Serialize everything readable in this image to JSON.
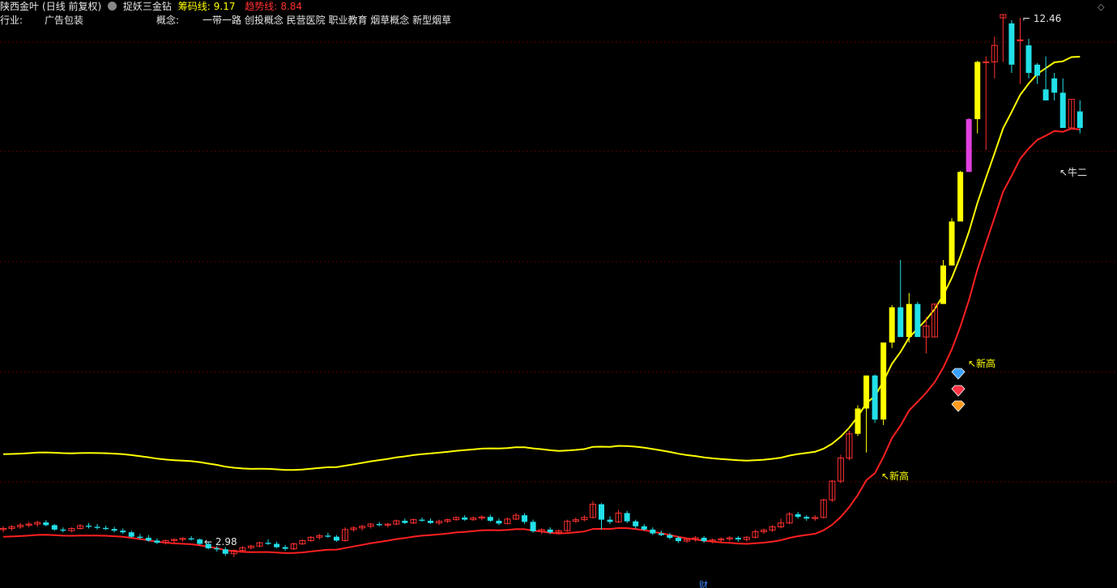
{
  "header": {
    "stock_name": "陕西金叶",
    "period_label": "(日线 前复权)",
    "indicator_name": "捉妖三金钻",
    "chip_line_label": "筹码线:",
    "chip_line_value": "9.17",
    "trend_line_label": "趋势线:",
    "trend_line_value": "8.84",
    "industry_label": "行业:",
    "industry_value": "广告包装",
    "concept_label": "概念:",
    "concept_value": "一带一路 创投概念 民营医院 职业教育 烟草概念 新型烟草"
  },
  "colors": {
    "background": "#000000",
    "up_candle": "#ff3030",
    "down_candle": "#22e0e8",
    "signal_candle": "#ffff00",
    "special_candle": "#e040e0",
    "chip_line": "#ffff00",
    "trend_line": "#ff2020",
    "grid": "#5a0000"
  },
  "chart_data": {
    "type": "candlestick",
    "max_price_label": "12.46",
    "min_price_label": "2.98",
    "annotations": [
      "新高",
      "新高",
      "牛二"
    ],
    "bottom_marker": "财",
    "diamond_icons": [
      "blue-diamond",
      "red-diamond",
      "orange-diamond"
    ],
    "candles": [
      {
        "o": 3.1,
        "h": 3.16,
        "l": 3.05,
        "c": 3.12
      },
      {
        "o": 3.12,
        "h": 3.18,
        "l": 3.08,
        "c": 3.15
      },
      {
        "o": 3.15,
        "h": 3.22,
        "l": 3.11,
        "c": 3.18
      },
      {
        "o": 3.18,
        "h": 3.24,
        "l": 3.14,
        "c": 3.2
      },
      {
        "o": 3.2,
        "h": 3.26,
        "l": 3.15,
        "c": 3.23
      },
      {
        "o": 3.23,
        "h": 3.27,
        "l": 3.16,
        "c": 3.18
      },
      {
        "o": 3.18,
        "h": 3.2,
        "l": 3.08,
        "c": 3.1
      },
      {
        "o": 3.1,
        "h": 3.14,
        "l": 3.05,
        "c": 3.08
      },
      {
        "o": 3.08,
        "h": 3.14,
        "l": 3.05,
        "c": 3.12
      },
      {
        "o": 3.12,
        "h": 3.2,
        "l": 3.1,
        "c": 3.17
      },
      {
        "o": 3.17,
        "h": 3.22,
        "l": 3.12,
        "c": 3.15
      },
      {
        "o": 3.15,
        "h": 3.2,
        "l": 3.1,
        "c": 3.13
      },
      {
        "o": 3.13,
        "h": 3.17,
        "l": 3.09,
        "c": 3.11
      },
      {
        "o": 3.11,
        "h": 3.15,
        "l": 3.05,
        "c": 3.08
      },
      {
        "o": 3.08,
        "h": 3.12,
        "l": 3.02,
        "c": 3.05
      },
      {
        "o": 3.05,
        "h": 3.08,
        "l": 2.95,
        "c": 2.97
      },
      {
        "o": 2.97,
        "h": 3.02,
        "l": 2.92,
        "c": 2.95
      },
      {
        "o": 2.95,
        "h": 3.0,
        "l": 2.88,
        "c": 2.9
      },
      {
        "o": 2.9,
        "h": 2.94,
        "l": 2.84,
        "c": 2.86
      },
      {
        "o": 2.86,
        "h": 2.92,
        "l": 2.83,
        "c": 2.9
      },
      {
        "o": 2.9,
        "h": 2.94,
        "l": 2.85,
        "c": 2.92
      },
      {
        "o": 2.92,
        "h": 2.96,
        "l": 2.88,
        "c": 2.94
      },
      {
        "o": 2.94,
        "h": 2.98,
        "l": 2.9,
        "c": 2.92
      },
      {
        "o": 2.92,
        "h": 2.94,
        "l": 2.82,
        "c": 2.84
      },
      {
        "o": 2.84,
        "h": 2.88,
        "l": 2.74,
        "c": 2.76
      },
      {
        "o": 2.76,
        "h": 2.8,
        "l": 2.7,
        "c": 2.74
      },
      {
        "o": 2.74,
        "h": 2.78,
        "l": 2.62,
        "c": 2.66
      },
      {
        "o": 2.66,
        "h": 2.74,
        "l": 2.6,
        "c": 2.72
      },
      {
        "o": 2.72,
        "h": 2.8,
        "l": 2.7,
        "c": 2.77
      },
      {
        "o": 2.77,
        "h": 2.82,
        "l": 2.74,
        "c": 2.8
      },
      {
        "o": 2.8,
        "h": 2.88,
        "l": 2.78,
        "c": 2.86
      },
      {
        "o": 2.86,
        "h": 2.92,
        "l": 2.82,
        "c": 2.84
      },
      {
        "o": 2.84,
        "h": 2.88,
        "l": 2.76,
        "c": 2.78
      },
      {
        "o": 2.78,
        "h": 2.82,
        "l": 2.72,
        "c": 2.75
      },
      {
        "o": 2.75,
        "h": 2.86,
        "l": 2.73,
        "c": 2.84
      },
      {
        "o": 2.84,
        "h": 2.92,
        "l": 2.82,
        "c": 2.9
      },
      {
        "o": 2.9,
        "h": 2.98,
        "l": 2.88,
        "c": 2.96
      },
      {
        "o": 2.96,
        "h": 3.02,
        "l": 2.92,
        "c": 2.99
      },
      {
        "o": 2.99,
        "h": 3.04,
        "l": 2.95,
        "c": 2.97
      },
      {
        "o": 2.97,
        "h": 3.0,
        "l": 2.88,
        "c": 2.9
      },
      {
        "o": 2.9,
        "h": 3.14,
        "l": 2.88,
        "c": 3.1
      },
      {
        "o": 3.1,
        "h": 3.16,
        "l": 3.06,
        "c": 3.13
      },
      {
        "o": 3.13,
        "h": 3.18,
        "l": 3.08,
        "c": 3.16
      },
      {
        "o": 3.16,
        "h": 3.22,
        "l": 3.12,
        "c": 3.2
      },
      {
        "o": 3.2,
        "h": 3.24,
        "l": 3.16,
        "c": 3.18
      },
      {
        "o": 3.18,
        "h": 3.22,
        "l": 3.14,
        "c": 3.2
      },
      {
        "o": 3.2,
        "h": 3.28,
        "l": 3.18,
        "c": 3.26
      },
      {
        "o": 3.26,
        "h": 3.3,
        "l": 3.2,
        "c": 3.22
      },
      {
        "o": 3.22,
        "h": 3.3,
        "l": 3.2,
        "c": 3.28
      },
      {
        "o": 3.28,
        "h": 3.32,
        "l": 3.24,
        "c": 3.26
      },
      {
        "o": 3.26,
        "h": 3.3,
        "l": 3.2,
        "c": 3.22
      },
      {
        "o": 3.22,
        "h": 3.28,
        "l": 3.18,
        "c": 3.25
      },
      {
        "o": 3.25,
        "h": 3.3,
        "l": 3.22,
        "c": 3.28
      },
      {
        "o": 3.28,
        "h": 3.34,
        "l": 3.26,
        "c": 3.32
      },
      {
        "o": 3.32,
        "h": 3.36,
        "l": 3.26,
        "c": 3.28
      },
      {
        "o": 3.28,
        "h": 3.34,
        "l": 3.26,
        "c": 3.31
      },
      {
        "o": 3.31,
        "h": 3.36,
        "l": 3.27,
        "c": 3.33
      },
      {
        "o": 3.33,
        "h": 3.37,
        "l": 3.24,
        "c": 3.26
      },
      {
        "o": 3.26,
        "h": 3.3,
        "l": 3.18,
        "c": 3.21
      },
      {
        "o": 3.21,
        "h": 3.32,
        "l": 3.19,
        "c": 3.29
      },
      {
        "o": 3.29,
        "h": 3.4,
        "l": 3.27,
        "c": 3.36
      },
      {
        "o": 3.36,
        "h": 3.4,
        "l": 3.2,
        "c": 3.24
      },
      {
        "o": 3.24,
        "h": 3.28,
        "l": 3.04,
        "c": 3.07
      },
      {
        "o": 3.07,
        "h": 3.12,
        "l": 3.02,
        "c": 3.1
      },
      {
        "o": 3.1,
        "h": 3.14,
        "l": 3.02,
        "c": 3.05
      },
      {
        "o": 3.05,
        "h": 3.1,
        "l": 3.02,
        "c": 3.08
      },
      {
        "o": 3.08,
        "h": 3.28,
        "l": 3.06,
        "c": 3.25
      },
      {
        "o": 3.25,
        "h": 3.32,
        "l": 3.22,
        "c": 3.28
      },
      {
        "o": 3.28,
        "h": 3.36,
        "l": 3.25,
        "c": 3.32
      },
      {
        "o": 3.32,
        "h": 3.62,
        "l": 3.3,
        "c": 3.56
      },
      {
        "o": 3.56,
        "h": 3.58,
        "l": 3.1,
        "c": 3.28
      },
      {
        "o": 3.28,
        "h": 3.34,
        "l": 3.2,
        "c": 3.24
      },
      {
        "o": 3.24,
        "h": 3.46,
        "l": 3.22,
        "c": 3.4
      },
      {
        "o": 3.4,
        "h": 3.44,
        "l": 3.22,
        "c": 3.25
      },
      {
        "o": 3.25,
        "h": 3.28,
        "l": 3.12,
        "c": 3.16
      },
      {
        "o": 3.16,
        "h": 3.2,
        "l": 3.08,
        "c": 3.1
      },
      {
        "o": 3.1,
        "h": 3.14,
        "l": 3.0,
        "c": 3.03
      },
      {
        "o": 3.03,
        "h": 3.08,
        "l": 2.98,
        "c": 3.0
      },
      {
        "o": 3.0,
        "h": 3.04,
        "l": 2.92,
        "c": 2.95
      },
      {
        "o": 2.95,
        "h": 2.98,
        "l": 2.86,
        "c": 2.89
      },
      {
        "o": 2.89,
        "h": 2.94,
        "l": 2.86,
        "c": 2.92
      },
      {
        "o": 2.92,
        "h": 2.98,
        "l": 2.88,
        "c": 2.95
      },
      {
        "o": 2.95,
        "h": 2.98,
        "l": 2.86,
        "c": 2.89
      },
      {
        "o": 2.89,
        "h": 2.94,
        "l": 2.85,
        "c": 2.91
      },
      {
        "o": 2.91,
        "h": 2.96,
        "l": 2.87,
        "c": 2.93
      },
      {
        "o": 2.93,
        "h": 2.98,
        "l": 2.89,
        "c": 2.95
      },
      {
        "o": 2.95,
        "h": 2.98,
        "l": 2.88,
        "c": 2.92
      },
      {
        "o": 2.92,
        "h": 2.98,
        "l": 2.88,
        "c": 2.96
      },
      {
        "o": 2.96,
        "h": 3.1,
        "l": 2.94,
        "c": 3.06
      },
      {
        "o": 3.06,
        "h": 3.12,
        "l": 3.02,
        "c": 3.09
      },
      {
        "o": 3.09,
        "h": 3.18,
        "l": 3.06,
        "c": 3.15
      },
      {
        "o": 3.15,
        "h": 3.3,
        "l": 3.12,
        "c": 3.22
      },
      {
        "o": 3.22,
        "h": 3.42,
        "l": 3.2,
        "c": 3.38
      },
      {
        "o": 3.38,
        "h": 3.42,
        "l": 3.3,
        "c": 3.33
      },
      {
        "o": 3.33,
        "h": 3.36,
        "l": 3.26,
        "c": 3.3
      },
      {
        "o": 3.3,
        "h": 3.36,
        "l": 3.26,
        "c": 3.32
      },
      {
        "o": 3.32,
        "h": 3.66,
        "l": 3.3,
        "c": 3.64
      },
      {
        "o": 3.64,
        "h": 4.0,
        "l": 3.6,
        "c": 3.98
      },
      {
        "o": 3.98,
        "h": 4.46,
        "l": 3.94,
        "c": 4.4
      },
      {
        "o": 4.4,
        "h": 4.9,
        "l": 4.36,
        "c": 4.84
      },
      {
        "o": 4.84,
        "h": 5.36,
        "l": 4.8,
        "c": 5.3
      },
      {
        "o": 5.3,
        "h": 5.9,
        "l": 4.5,
        "c": 5.9
      },
      {
        "o": 5.9,
        "h": 5.92,
        "l": 5.04,
        "c": 5.1
      },
      {
        "o": 5.1,
        "h": 6.5,
        "l": 5.0,
        "c": 6.5
      },
      {
        "o": 6.5,
        "h": 7.18,
        "l": 6.4,
        "c": 7.14
      },
      {
        "o": 7.14,
        "h": 8.0,
        "l": 6.6,
        "c": 6.6
      },
      {
        "o": 6.6,
        "h": 7.4,
        "l": 6.5,
        "c": 7.2
      },
      {
        "o": 7.2,
        "h": 7.24,
        "l": 6.6,
        "c": 6.6
      },
      {
        "o": 6.6,
        "h": 6.96,
        "l": 6.3,
        "c": 6.8
      },
      {
        "o": 6.6,
        "h": 7.2,
        "l": 6.6,
        "c": 7.2
      },
      {
        "o": 7.2,
        "h": 8.0,
        "l": 7.2,
        "c": 7.9
      },
      {
        "o": 7.9,
        "h": 8.76,
        "l": 7.9,
        "c": 8.7
      },
      {
        "o": 8.7,
        "h": 9.62,
        "l": 8.7,
        "c": 9.6
      },
      {
        "o": 9.6,
        "h": 10.58,
        "l": 9.6,
        "c": 10.56
      },
      {
        "o": 10.56,
        "h": 11.62,
        "l": 10.3,
        "c": 11.6
      },
      {
        "o": 11.6,
        "h": 11.7,
        "l": 10.0,
        "c": 11.6
      },
      {
        "o": 11.6,
        "h": 12.06,
        "l": 11.3,
        "c": 11.9
      },
      {
        "o": 12.4,
        "h": 12.46,
        "l": 11.6,
        "c": 12.46
      },
      {
        "o": 12.3,
        "h": 12.36,
        "l": 11.4,
        "c": 11.55
      },
      {
        "o": 12.0,
        "h": 12.4,
        "l": 11.2,
        "c": 12.0
      },
      {
        "o": 11.9,
        "h": 12.02,
        "l": 11.3,
        "c": 11.4
      },
      {
        "o": 11.55,
        "h": 11.58,
        "l": 11.2,
        "c": 11.35
      },
      {
        "o": 11.1,
        "h": 11.7,
        "l": 10.9,
        "c": 10.9
      },
      {
        "o": 11.3,
        "h": 11.4,
        "l": 10.9,
        "c": 11.04
      },
      {
        "o": 11.04,
        "h": 11.3,
        "l": 10.4,
        "c": 10.4
      },
      {
        "o": 10.4,
        "h": 10.92,
        "l": 10.4,
        "c": 10.92
      },
      {
        "o": 10.7,
        "h": 10.9,
        "l": 10.3,
        "c": 10.4
      }
    ]
  }
}
